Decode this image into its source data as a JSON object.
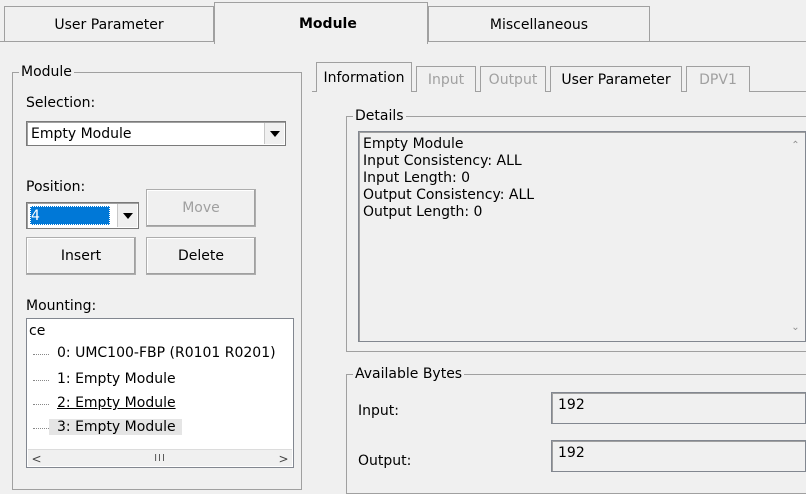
{
  "top_tabs": [
    {
      "label": "User Parameter",
      "active": false
    },
    {
      "label": "Module",
      "active": true
    },
    {
      "label": "Miscellaneous",
      "active": false
    }
  ],
  "module_group": {
    "legend": "Module",
    "selection_label": "Selection:",
    "selection_value": "Empty Module",
    "position_label": "Position:",
    "position_value": "4",
    "move_label": "Move",
    "insert_label": "Insert",
    "delete_label": "Delete",
    "mounting_label": "Mounting:",
    "tree": {
      "root_fragment": "ce",
      "items": [
        "0: UMC100-FBP (R0101 R0201)",
        "1: Empty Module",
        "2: Empty Module",
        "3: Empty Module"
      ],
      "scroll_thumb": "III"
    }
  },
  "inner_tabs": [
    {
      "label": "Information",
      "active": true,
      "enabled": true
    },
    {
      "label": "Input",
      "active": false,
      "enabled": false
    },
    {
      "label": "Output",
      "active": false,
      "enabled": false
    },
    {
      "label": "User Parameter",
      "active": false,
      "enabled": true
    },
    {
      "label": "DPV1",
      "active": false,
      "enabled": false
    }
  ],
  "details": {
    "legend": "Details",
    "lines": [
      "Empty Module",
      "Input Consistency: ALL",
      "Input Length: 0",
      "Output Consistency: ALL",
      "Output Length: 0"
    ]
  },
  "available_bytes": {
    "legend": "Available Bytes",
    "input_label": "Input:",
    "input_value": "192",
    "output_label": "Output:",
    "output_value": "192"
  },
  "icons": {
    "dropdown": "chevron-down-icon",
    "scroll_up": "scroll-up-icon",
    "scroll_down": "scroll-down-icon",
    "scroll_left": "scroll-left-icon",
    "scroll_right": "scroll-right-icon"
  },
  "colors": {
    "window_bg": "#f0f0f0",
    "selection_bg": "#0078d7",
    "border": "#a0a0a0"
  }
}
